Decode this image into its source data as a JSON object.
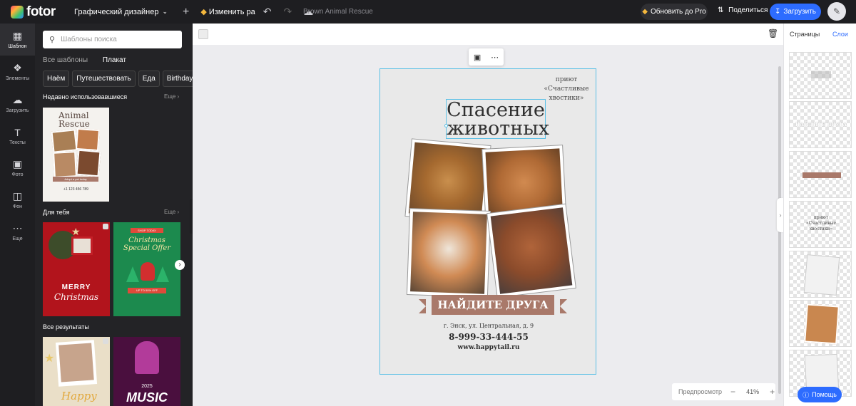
{
  "topbar": {
    "logo": "fotor",
    "mode": "Графический дизайнер",
    "resize": "Изменить ра",
    "title": "Brown Animal Rescue",
    "pro": "Обновить до Pro",
    "share": "Поделиться",
    "upload": "Загрузить"
  },
  "rail": [
    {
      "label": "Шаблон",
      "icon": "template-icon"
    },
    {
      "label": "Элементы",
      "icon": "elements-icon"
    },
    {
      "label": "Загрузить",
      "icon": "upload-icon"
    },
    {
      "label": "Тексты",
      "icon": "text-icon"
    },
    {
      "label": "Фото",
      "icon": "photo-icon"
    },
    {
      "label": "Фон",
      "icon": "background-icon"
    },
    {
      "label": "Еще",
      "icon": "more-icon"
    }
  ],
  "panel": {
    "search_placeholder": "Шаблоны поиска",
    "crumb_all": "Все шаблоны",
    "crumb_current": "Плакат",
    "chips": [
      "Наём",
      "Путешествовать",
      "Еда",
      "Birthday"
    ],
    "recent_title": "Недавно использовавшиеся",
    "more": "Еще",
    "for_you_title": "Для тебя",
    "all_results_title": "Все результаты",
    "recent_thumb": {
      "title1": "Animal",
      "title2": "Rescue",
      "tag": "Adopt a pet today",
      "phone": "+1 123 456 789"
    },
    "xmas": {
      "line1": "MERRY",
      "line2": "Christmas"
    },
    "offer": {
      "top": "SHOP TODAY",
      "title1": "Christmas",
      "title2": "Special Offer",
      "badge": "UP TO 50% OFF"
    },
    "music": {
      "year": "2025",
      "word": "MUSIC"
    },
    "happy": "Happy"
  },
  "poster": {
    "shelter": [
      "приют",
      "«Счастливые",
      "хвостики»"
    ],
    "headline1": "Спасение",
    "headline2": "животных",
    "banner": "НАЙДИТЕ ДРУГА",
    "address": "г. Энск, ул. Центральная, д. 9",
    "phone": "8-999-33-444-55",
    "site": "www.happytail.ru"
  },
  "right_panel": {
    "tab_pages": "Страницы",
    "tab_layers": "Слои",
    "layer_text1": "НАЙДИТЕ ДРУГА",
    "layer_text2": [
      "приют",
      "«Счастливые",
      "хвостики»"
    ]
  },
  "zoom": {
    "preview": "Предпросмотр",
    "value": "41%"
  },
  "help": "Помощь",
  "colors": {
    "accent": "#2d6cff",
    "banner": "#a9796a",
    "selection": "#5bc0e6",
    "dark": "#1e1e21"
  }
}
